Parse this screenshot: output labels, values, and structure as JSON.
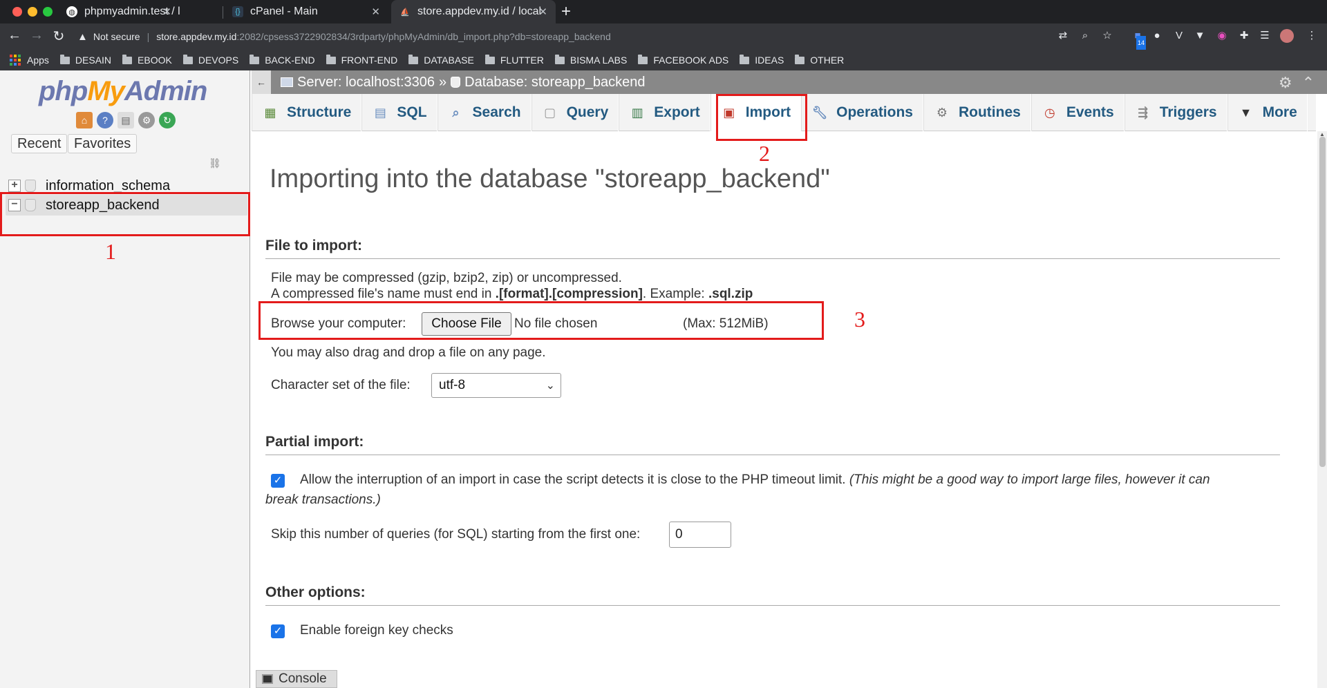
{
  "browser": {
    "tabs": [
      {
        "title": "phpmyadmin.test / localh",
        "favicon": "phpmyadmin-favicon"
      },
      {
        "title": "cPanel - Main",
        "favicon": "cpanel-favicon"
      },
      {
        "title": "store.appdev.my.id / local",
        "favicon": "phpmyadmin-favicon"
      }
    ],
    "new_tab": "+",
    "security_label": "Not secure",
    "url_host": "store.appdev.my.id",
    "url_rest": ":2082/cpsess3722902834/3rdparty/phpMyAdmin/db_import.php?db=storeapp_backend",
    "extension_badge": "14",
    "bookmarks": [
      "Apps",
      "DESAIN",
      "EBOOK",
      "DEVOPS",
      "BACK-END",
      "FRONT-END",
      "DATABASE",
      "FLUTTER",
      "BISMA LABS",
      "FACEBOOK ADS",
      "IDEAS",
      "OTHER"
    ]
  },
  "sidebar": {
    "logo": {
      "part1": "php",
      "part2": "My",
      "part3": "Admin"
    },
    "recent_label": "Recent",
    "favorites_label": "Favorites",
    "databases": [
      {
        "name": "information_schema",
        "expander": "+"
      },
      {
        "name": "storeapp_backend",
        "expander": "−"
      }
    ]
  },
  "breadcrumb": {
    "server": "Server: localhost:3306",
    "separator": "»",
    "database": "Database: storeapp_backend"
  },
  "tabs": [
    {
      "label": "Structure",
      "icon": "structure-icon"
    },
    {
      "label": "SQL",
      "icon": "sql-icon"
    },
    {
      "label": "Search",
      "icon": "search-icon"
    },
    {
      "label": "Query",
      "icon": "query-icon"
    },
    {
      "label": "Export",
      "icon": "export-icon"
    },
    {
      "label": "Import",
      "icon": "import-icon",
      "active": true
    },
    {
      "label": "Operations",
      "icon": "wrench-icon"
    },
    {
      "label": "Routines",
      "icon": "routines-icon"
    },
    {
      "label": "Events",
      "icon": "clock-icon"
    },
    {
      "label": "Triggers",
      "icon": "triggers-icon"
    },
    {
      "label": "More",
      "icon": "caret-down-icon"
    }
  ],
  "page": {
    "title": "Importing into the database \"storeapp_backend\"",
    "file_section": "File to import:",
    "compress_line1": "File may be compressed (gzip, bzip2, zip) or uncompressed.",
    "compress_line2_prefix": "A compressed file's name must end in ",
    "compress_line2_bold": ".[format].[compression]",
    "compress_line2_mid": ". Example: ",
    "compress_line2_example": ".sql.zip",
    "browse_label": "Browse your computer:",
    "choose_file_button": "Choose File",
    "no_file_text": "No file chosen",
    "max_size": "(Max: 512MiB)",
    "drag_hint": "You may also drag and drop a file on any page.",
    "charset_label": "Character set of the file:",
    "charset_value": "utf-8",
    "partial_section": "Partial import:",
    "allow_interrupt_text": "Allow the interruption of an import in case the script detects it is close to the PHP timeout limit.",
    "allow_interrupt_note_1": "(This might be a good way to import large files, however it can",
    "allow_interrupt_note_2": "break transactions.)",
    "allow_interrupt_checked": true,
    "skip_label": "Skip this number of queries (for SQL) starting from the first one:",
    "skip_value": "0",
    "other_section": "Other options:",
    "fk_label": "Enable foreign key checks",
    "fk_checked": true,
    "console_label": "Console"
  },
  "annotations": [
    "1",
    "2",
    "3"
  ],
  "colors": {
    "annotation_red": "#e31b1b",
    "tab_text": "#235a81",
    "checkbox": "#1a73e8",
    "logo_blue": "#6c78af",
    "logo_orange": "#f89c0e"
  }
}
